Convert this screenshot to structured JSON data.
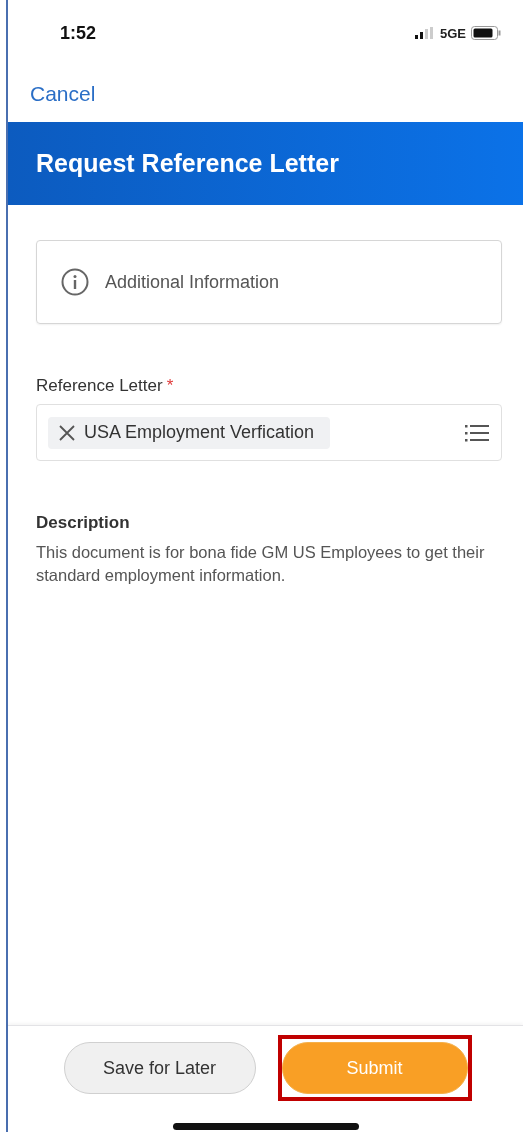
{
  "status_bar": {
    "time": "1:52",
    "network": "5GE"
  },
  "nav": {
    "cancel": "Cancel"
  },
  "header": {
    "title": "Request Reference Letter"
  },
  "info_card": {
    "label": "Additional Information"
  },
  "reference_letter": {
    "label": "Reference Letter",
    "required": true,
    "required_mark": "*",
    "value": "USA Employment Verfication"
  },
  "description": {
    "label": "Description",
    "text": "This document is for bona fide GM US Employees to get their standard employment information."
  },
  "buttons": [
    {
      "label": "Save for Later",
      "kind": "secondary",
      "highlighted": false
    },
    {
      "label": "Submit",
      "kind": "primary",
      "highlighted": true
    }
  ]
}
